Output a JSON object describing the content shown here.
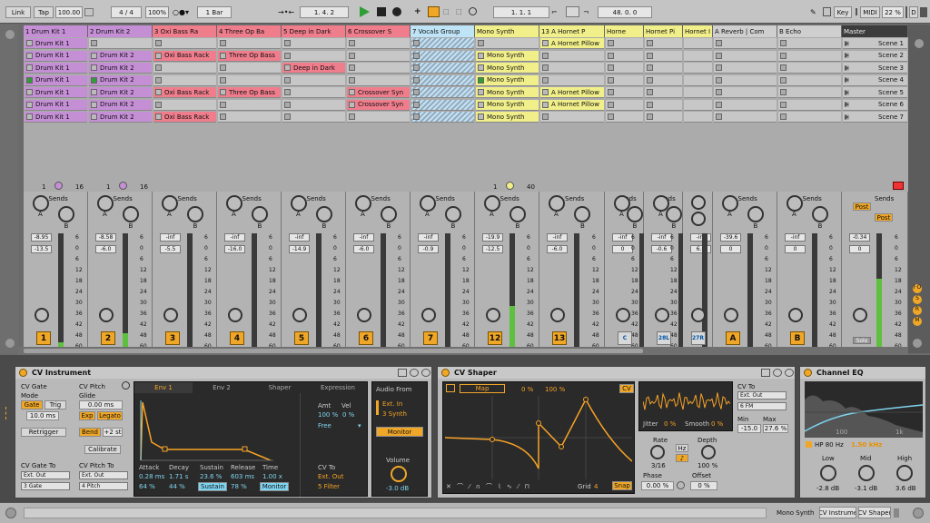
{
  "transport": {
    "link": "Link",
    "tap": "Tap",
    "tempo": "100.00",
    "meter": "4 / 4",
    "zoom": "100%",
    "quant": "1 Bar",
    "arr_pos": "1.   4.   2",
    "loop_start": "1.   1.   1",
    "loop_len": "48.   0.   0",
    "key": "Key",
    "midi": "MIDI",
    "cpu": "22 %",
    "d": "D"
  },
  "tracks": [
    {
      "name": "1 Drum Kit 1",
      "color": "#c58fd6",
      "clips": [
        "Drum Kit 1",
        "Drum Kit 1",
        "Drum Kit 1",
        "Drum Kit 1",
        "Drum Kit 1",
        "Drum Kit 1",
        "Drum Kit 1"
      ],
      "playing": 3,
      "mon_a": "1",
      "mon_b": "16",
      "v1": "-8.95",
      "v2": "-13.5",
      "num": "1"
    },
    {
      "name": "2 Drum Kit 2",
      "color": "#c58fd6",
      "clips": [
        "",
        "Drum Kit 2",
        "Drum Kit 2",
        "Drum Kit 2",
        "Drum Kit 2",
        "Drum Kit 2",
        "Drum Kit 2"
      ],
      "playing": 3,
      "mon_a": "1",
      "mon_b": "16",
      "v1": "-8.58",
      "v2": "-6.0",
      "num": "2"
    },
    {
      "name": "3 Oxi Bass Ra",
      "color": "#ef7d8c",
      "clips": [
        "",
        "Oxi Bass Rack",
        "",
        "",
        "Oxi Bass Rack",
        "",
        "Oxi Bass Rack"
      ],
      "v1": "-inf",
      "v2": "-5.5",
      "num": "3"
    },
    {
      "name": "4 Three Op Ba",
      "color": "#ef7d8c",
      "clips": [
        "",
        "Three Op Bass",
        "",
        "",
        "Three Op Bass",
        "",
        ""
      ],
      "v1": "-inf",
      "v2": "-16.0",
      "num": "4"
    },
    {
      "name": "5 Deep in Dark",
      "color": "#ef7d8c",
      "clips": [
        "",
        "",
        "Deep in Dark",
        "",
        "",
        "",
        ""
      ],
      "v1": "-inf",
      "v2": "-14.9",
      "num": "5"
    },
    {
      "name": "6 Crossover S",
      "color": "#ef7d8c",
      "clips": [
        "",
        "",
        "",
        "",
        "Crossover Syn",
        "Crossover Syn",
        ""
      ],
      "v1": "-inf",
      "v2": "-6.0",
      "num": "6"
    },
    {
      "name": "7 Vocals Group",
      "color": "#bfe4f7",
      "clips": [
        "",
        "",
        "",
        "",
        "",
        "",
        ""
      ],
      "v1": "-inf",
      "v2": "-0.9",
      "num": "7"
    },
    {
      "name": "Mono Synth",
      "color": "#f1ef8a",
      "clips": [
        "",
        "Mono Synth",
        "Mono Synth",
        "Mono Synth",
        "Mono Synth",
        "Mono Synth",
        "Mono Synth"
      ],
      "playing": 3,
      "mon_a": "1",
      "mon_b": "40",
      "v1": "-19.9",
      "v2": "-12.5",
      "num": "12"
    },
    {
      "name": "13 A Hornet P",
      "color": "#f1ef8a",
      "clips": [
        "A Hornet Pillow",
        "",
        "",
        "",
        "A Hornet Pillow",
        "A Hornet Pillow",
        ""
      ],
      "v1": "-inf",
      "v2": "-6.0",
      "num": "13"
    },
    {
      "name": "Horne",
      "color": "#f1ef8a",
      "clips": [],
      "v1": "-inf",
      "v2": "0",
      "num": "C"
    },
    {
      "name": "Hornet Pi",
      "color": "#f1ef8a",
      "clips": [],
      "v1": "-inf",
      "v2": "-0.6",
      "num": "28L"
    },
    {
      "name": "Hornet I",
      "color": "#f1ef8a",
      "clips": [],
      "v1": "-inf",
      "v2": "6.0",
      "num": "27R"
    },
    {
      "name": "A Reverb | Com",
      "color": "#cfcfcf",
      "clips": [],
      "v1": "-39.6",
      "v2": "0",
      "num": "A"
    },
    {
      "name": "B Echo",
      "color": "#cfcfcf",
      "clips": [],
      "v1": "-inf",
      "v2": "0",
      "num": "B"
    }
  ],
  "master": {
    "name": "Master",
    "scenes": [
      "Scene 1",
      "Scene 2",
      "Scene 3",
      "Scene 4",
      "Scene 5",
      "Scene 6",
      "Scene 7"
    ],
    "v1": "-0.34",
    "v2": "0",
    "post1": "Post",
    "post2": "Post",
    "solo": "Solo"
  },
  "sends": "Sends",
  "knob_a": "A",
  "knob_b": "B",
  "s_label": "S",
  "scale": [
    "6",
    "0",
    "6",
    "12",
    "18",
    "24",
    "30",
    "36",
    "42",
    "48",
    "60"
  ],
  "cvi": {
    "title": "CV Instrument",
    "gate": "CV Gate",
    "mode": "Mode",
    "gate_btn": "Gate",
    "trig": "Trig",
    "gate_ms": "10.0 ms",
    "retrigger": "Retrigger",
    "gate_to": "CV Gate To",
    "gate_out": "Ext. Out",
    "gate_ch": "3 Gate",
    "pitch": "CV Pitch",
    "glide": "Glide",
    "glide_ms": "0.00 ms",
    "exp": "Exp",
    "legato": "Legato",
    "bend": "Bend",
    "bend_st": "+2 st",
    "calibrate": "Calibrate",
    "pitch_to": "CV Pitch To",
    "pitch_out": "Ext. Out",
    "pitch_ch": "4 Pitch",
    "env1": "Env 1",
    "env2": "Env 2",
    "shaper": "Shaper",
    "expression": "Expression",
    "attack": "Attack",
    "decay": "Decay",
    "sustain": "Sustain",
    "release": "Release",
    "time": "Time",
    "attack_v": "0.28 ms",
    "decay_v": "1.71 s",
    "sustain_v": "23.6 %",
    "release_v": "603 ms",
    "time_v": "1.00 x",
    "attack_p": "64 %",
    "decay_p": "44 %",
    "sustain_btn": "Sustain",
    "release_p": "78 %",
    "monitor": "Monitor",
    "amt": "Amt",
    "vel": "Vel",
    "amt_v": "100 %",
    "vel_v": "0 %",
    "free": "Free",
    "cvto": "CV To",
    "cvto_out": "Ext. Out",
    "cvto_ch": "5 Filter",
    "audio_from": "Audio From",
    "ext_in": "Ext. In",
    "synth": "3 Synth",
    "monitor2": "Monitor",
    "volume": "Volume",
    "vol_v": "-3.0 dB"
  },
  "cvs": {
    "title": "CV Shaper",
    "map": "Map",
    "p0": "0 %",
    "p100": "100 %",
    "cv": "CV",
    "grid": "Grid",
    "grid_v": "4",
    "snap": "Snap",
    "jitter": "Jitter",
    "jitter_v": "0 %",
    "smooth": "Smooth",
    "smooth_v": "0 %",
    "rate": "Rate",
    "rate_v": "3/16",
    "hz": "Hz",
    "depth": "Depth",
    "depth_v": "100 %",
    "phase": "Phase",
    "phase_v": "0.00 %",
    "offset": "Offset",
    "offset_v": "0 %",
    "cvto": "CV To",
    "out": "Ext. Out",
    "ch": "6 FM",
    "min": "Min",
    "max": "Max",
    "min_v": "-15.0",
    "max_v": "27.6 %"
  },
  "eq": {
    "title": "Channel EQ",
    "hp": "HP 80 Hz",
    "khz": "1.50 kHz",
    "low": "Low",
    "mid": "Mid",
    "high": "High",
    "low_v": "-2.8 dB",
    "mid_v": "-3.1 dB",
    "high_v": "3.6 dB",
    "f100": "100",
    "f1k": "1k"
  },
  "status": {
    "track": "Mono Synth",
    "dev1": "CV Instrume",
    "dev2": "CV Shaper"
  }
}
